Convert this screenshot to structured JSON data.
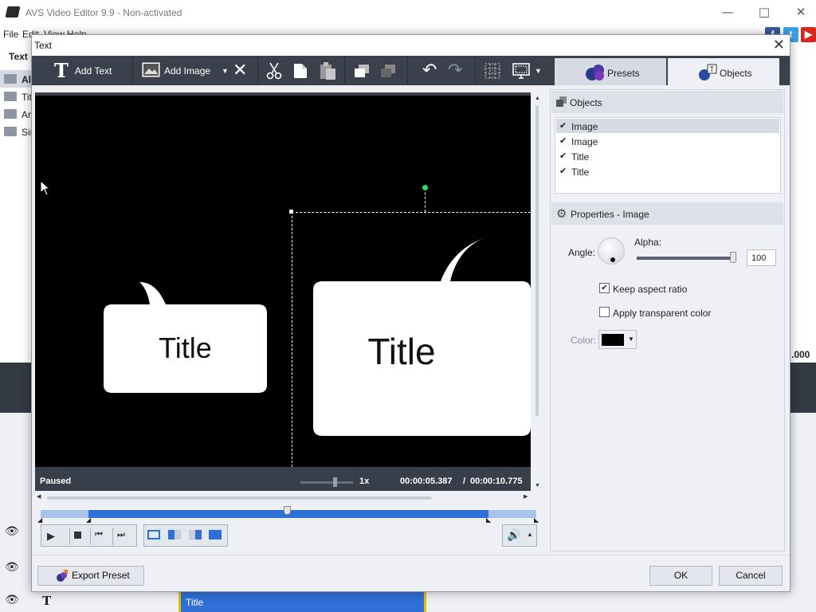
{
  "app": {
    "title": "AVS Video Editor 9.9 - Non-activated",
    "menu": [
      "File",
      "Edit",
      "View",
      "Help"
    ],
    "left_tab": "Text",
    "left_items": [
      "All",
      "Tit",
      "Ar",
      "Sir"
    ],
    "clip_title": "Title",
    "right_time_fragment": ".000"
  },
  "dialog": {
    "title": "Text",
    "toolbar": {
      "add_text": "Add Text",
      "add_image": "Add Image"
    },
    "tabs": {
      "presets": "Presets",
      "objects": "Objects"
    },
    "preview": {
      "bubble_small_text": "Title",
      "bubble_large_text": "Title"
    },
    "status": {
      "state": "Paused",
      "speed": "1x",
      "current_time": "00:00:05.387",
      "total_time": "00:00:10.775",
      "separator": "/"
    },
    "objects_panel": {
      "header": "Objects",
      "items": [
        {
          "label": "Image",
          "checked": true,
          "selected": true
        },
        {
          "label": "Image",
          "checked": true,
          "selected": false
        },
        {
          "label": "Title",
          "checked": true,
          "selected": false
        },
        {
          "label": "Title",
          "checked": true,
          "selected": false
        }
      ]
    },
    "properties": {
      "header": "Properties - Image",
      "angle_label": "Angle:",
      "alpha_label": "Alpha:",
      "alpha_value": "100",
      "keep_aspect_label": "Keep aspect ratio",
      "keep_aspect_checked": true,
      "apply_transparent_label": "Apply transparent color",
      "apply_transparent_checked": false,
      "color_label": "Color:",
      "color_value": "#000000"
    },
    "buttons": {
      "export_preset": "Export Preset",
      "ok": "OK",
      "cancel": "Cancel"
    }
  }
}
